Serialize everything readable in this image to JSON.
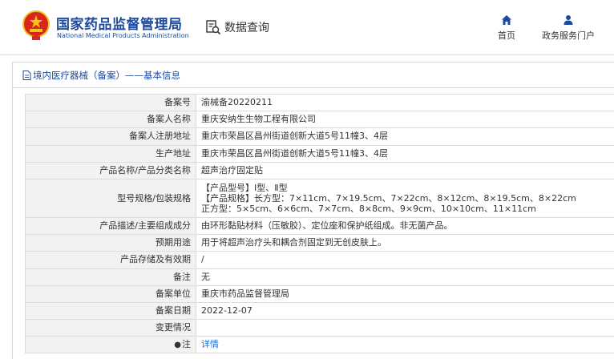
{
  "header": {
    "org_name_cn": "国家药品监督管理局",
    "org_name_en": "National Medical Products Administration",
    "query_label": "数据查询",
    "nav": [
      {
        "label": "首页",
        "icon": "home-icon"
      },
      {
        "label": "政务服务门户",
        "icon": "user-icon"
      }
    ]
  },
  "breadcrumb": {
    "text": "境内医疗器械（备案）——基本信息"
  },
  "colors": {
    "brand_blue": "#1d4a9c",
    "link_blue": "#1d6fd6",
    "label_bg": "#f2f2f2",
    "emblem_red": "#d7261b",
    "emblem_gold": "#f3c21b"
  },
  "record": {
    "rows": [
      {
        "label": "备案号",
        "value": "渝械备20220211"
      },
      {
        "label": "备案人名称",
        "value": "重庆安纳生生物工程有限公司"
      },
      {
        "label": "备案人注册地址",
        "value": "重庆市荣昌区昌州街道创新大道5号11幢3、4层"
      },
      {
        "label": "生产地址",
        "value": "重庆市荣昌区昌州街道创新大道5号11幢3、4层"
      },
      {
        "label": "产品名称/产品分类名称",
        "value": "超声治疗固定贴"
      }
    ],
    "model_row": {
      "label": "型号规格/包装规格",
      "line1": "【产品型号】Ⅰ型、Ⅱ型",
      "line2": "【产品规格】长方型：7×11cm、7×19.5cm、7×22cm、8×12cm、8×19.5cm、8×22cm",
      "line3": "正方型：5×5cm、6×6cm、7×7cm、8×8cm、9×9cm、10×10cm、11×11cm"
    },
    "rows_after": [
      {
        "label": "产品描述/主要组成成分",
        "value": "由环形黏贴材料（压敏胶）、定位座和保护纸组成。非无菌产品。"
      },
      {
        "label": "预期用途",
        "value": "用于将超声治疗头和耦合剂固定到无创皮肤上。"
      },
      {
        "label": "产品存储及有效期",
        "value": "/"
      },
      {
        "label": "备注",
        "value": "无"
      },
      {
        "label": "备案单位",
        "value": "重庆市药品监督管理局"
      },
      {
        "label": "备案日期",
        "value": "2022-12-07"
      },
      {
        "label": "变更情况",
        "value": ""
      }
    ],
    "detail_row": {
      "label": "注",
      "link": "详情"
    }
  }
}
